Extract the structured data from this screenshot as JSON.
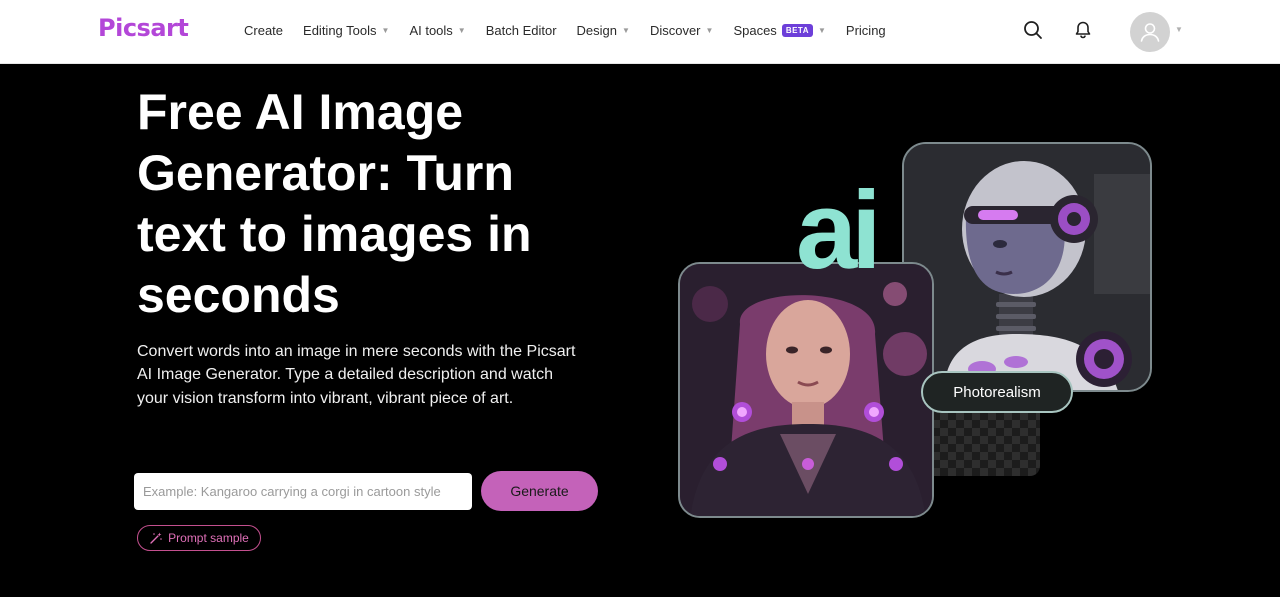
{
  "header": {
    "logo": "Picsart",
    "nav": [
      {
        "label": "Create",
        "dropdown": false
      },
      {
        "label": "Editing Tools",
        "dropdown": true
      },
      {
        "label": "AI tools",
        "dropdown": true
      },
      {
        "label": "Batch Editor",
        "dropdown": false
      },
      {
        "label": "Design",
        "dropdown": true
      },
      {
        "label": "Discover",
        "dropdown": true
      },
      {
        "label": "Spaces",
        "badge": "BETA",
        "dropdown": true
      },
      {
        "label": "Pricing",
        "dropdown": false
      }
    ],
    "icons": [
      "search-icon",
      "bell-icon",
      "user-icon"
    ]
  },
  "hero": {
    "title": "Free AI Image Generator: Turn text to images in seconds",
    "description": "Convert words into an image in mere seconds with the Picsart AI Image Generator. Type a detailed description and watch your vision transform into vibrant, vibrant piece of art.",
    "input_placeholder": "Example: Kangaroo carrying a corgi in cartoon style",
    "input_value": "",
    "generate_label": "Generate",
    "sample_label": "Prompt sample"
  },
  "art": {
    "ai_text": "ai",
    "badge": "Photorealism"
  },
  "colors": {
    "brand": "#b347d8",
    "generate_button": "#c462b9",
    "accent_teal": "#8ee3d2",
    "beta_badge": "#6d3fd9",
    "hero_bg": "#000000"
  }
}
